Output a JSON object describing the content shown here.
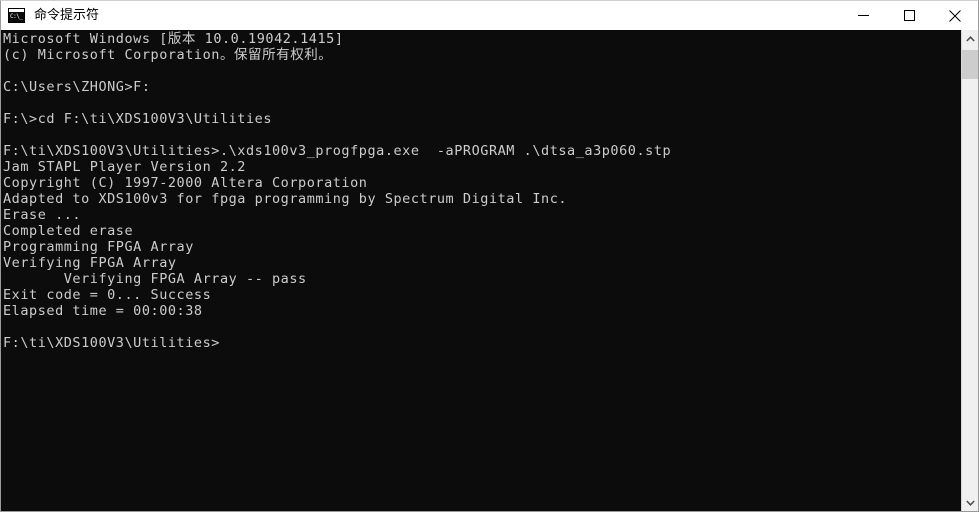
{
  "window": {
    "title": "命令提示符",
    "icon": "cmd-console-icon",
    "controls": {
      "minimize_label": "最小化",
      "maximize_label": "最大化",
      "close_label": "关闭"
    },
    "background_color": "#0c0c0c",
    "titlebar_color": "#ffffff",
    "text_color": "#cccccc"
  },
  "terminal": {
    "lines": [
      "Microsoft Windows [版本 10.0.19042.1415]",
      "(c) Microsoft Corporation。保留所有权利。",
      "",
      "C:\\Users\\ZHONG>F:",
      "",
      "F:\\>cd F:\\ti\\XDS100V3\\Utilities",
      "",
      "F:\\ti\\XDS100V3\\Utilities>.\\xds100v3_progfpga.exe  -aPROGRAM .\\dtsa_a3p060.stp",
      "Jam STAPL Player Version 2.2",
      "Copyright (C) 1997-2000 Altera Corporation",
      "Adapted to XDS100v3 for fpga programming by Spectrum Digital Inc.",
      "Erase ...",
      "Completed erase",
      "Programming FPGA Array",
      "Verifying FPGA Array",
      "       Verifying FPGA Array -- pass",
      "Exit code = 0... Success",
      "Elapsed time = 00:00:38",
      "",
      "F:\\ti\\XDS100V3\\Utilities>"
    ],
    "text": "Microsoft Windows [版本 10.0.19042.1415]\n(c) Microsoft Corporation。保留所有权利。\n\nC:\\Users\\ZHONG>F:\n\nF:\\>cd F:\\ti\\XDS100V3\\Utilities\n\nF:\\ti\\XDS100V3\\Utilities>.\\xds100v3_progfpga.exe  -aPROGRAM .\\dtsa_a3p060.stp\nJam STAPL Player Version 2.2\nCopyright (C) 1997-2000 Altera Corporation\nAdapted to XDS100v3 for fpga programming by Spectrum Digital Inc.\nErase ...\nCompleted erase\nProgramming FPGA Array\nVerifying FPGA Array\n       Verifying FPGA Array -- pass\nExit code = 0... Success\nElapsed time = 00:00:38\n\nF:\\ti\\XDS100V3\\Utilities>"
  },
  "scrollbar": {
    "up_arrow": "chevron-up-icon",
    "down_arrow": "chevron-down-icon"
  }
}
